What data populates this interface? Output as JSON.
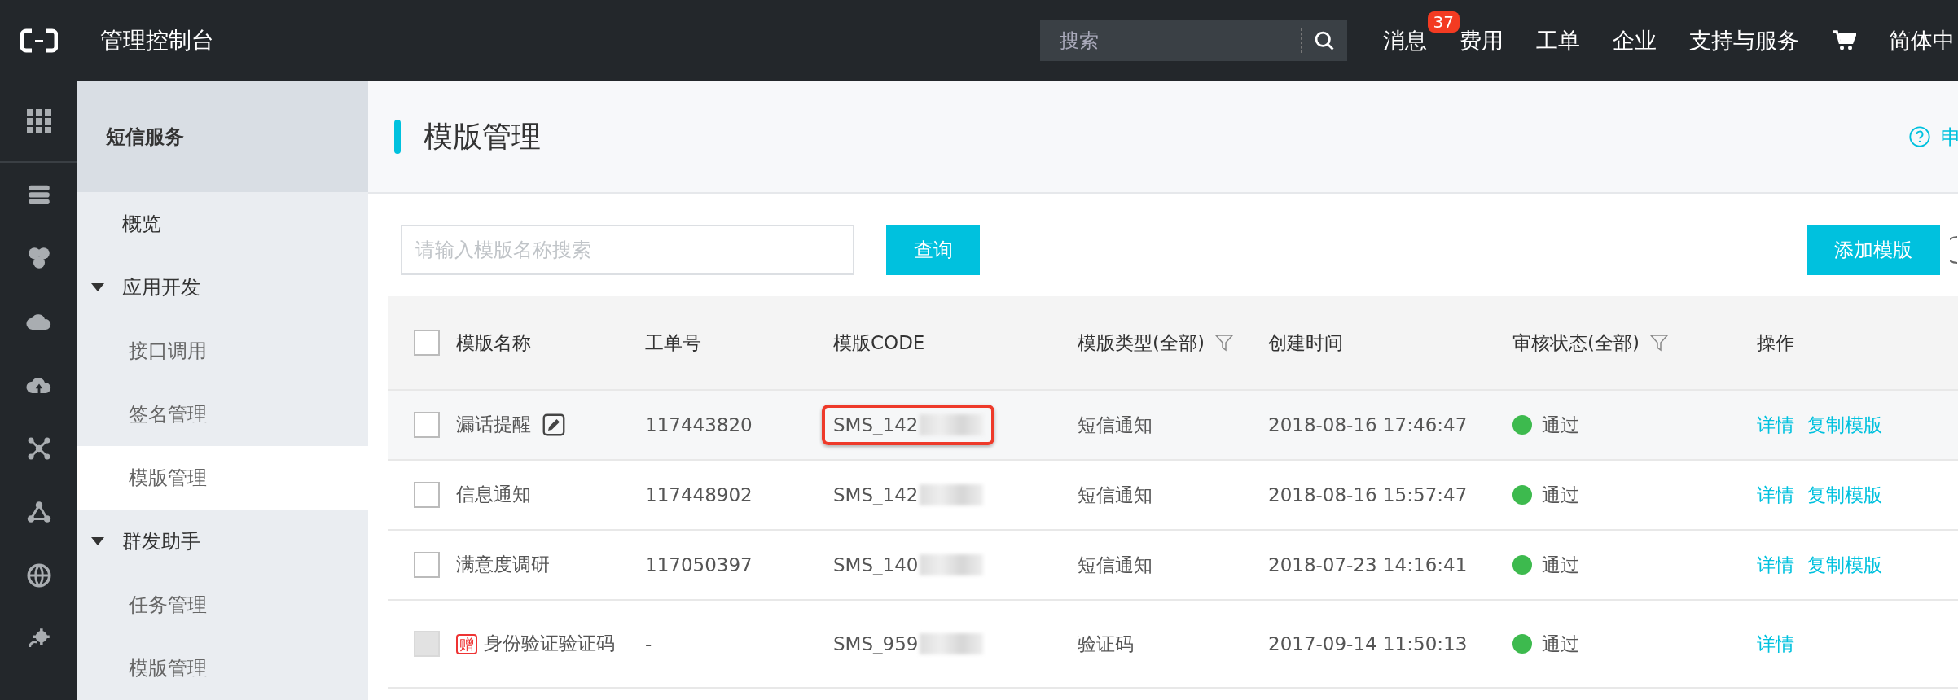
{
  "topbar": {
    "title": "管理控制台",
    "search": {
      "placeholder": "搜索"
    },
    "nav": [
      {
        "label": "消息",
        "badge": "37"
      },
      {
        "label": "费用"
      },
      {
        "label": "工单"
      },
      {
        "label": "企业"
      },
      {
        "label": "支持与服务"
      },
      {
        "kind": "cart"
      },
      {
        "label": "简体中"
      }
    ]
  },
  "sidebar": {
    "title": "短信服务",
    "items": [
      {
        "label": "概览",
        "kind": "link",
        "selected": false
      },
      {
        "label": "应用开发",
        "kind": "group",
        "expanded": true,
        "children": [
          {
            "label": "接口调用",
            "selected": false
          },
          {
            "label": "签名管理",
            "selected": false
          },
          {
            "label": "模版管理",
            "selected": true
          }
        ]
      },
      {
        "label": "群发助手",
        "kind": "group",
        "expanded": true,
        "children": [
          {
            "label": "任务管理",
            "selected": false
          },
          {
            "label": "模版管理",
            "selected": false
          }
        ]
      }
    ]
  },
  "page": {
    "title": "模版管理",
    "help_link": "申"
  },
  "toolbar": {
    "search": {
      "placeholder": "请输入模版名称搜索"
    },
    "query_button": "查询",
    "add_button": "添加模版"
  },
  "table": {
    "select_all": {
      "checked": false
    },
    "columns": [
      {
        "label": "模版名称"
      },
      {
        "label": "工单号"
      },
      {
        "label": "模版CODE"
      },
      {
        "label": "模版类型(全部)",
        "filter": true
      },
      {
        "label": "创建时间"
      },
      {
        "label": "审核状态(全部)",
        "filter": true
      },
      {
        "label": "操作"
      }
    ],
    "rows": [
      {
        "name": "漏话提醒",
        "hovered": true,
        "order_no": "117443820",
        "code": "SMS_142",
        "highlighted": true,
        "type": "短信通知",
        "created": "2018-08-16 17:46:47",
        "status": "通过",
        "color": "#3dba4e",
        "actions": [
          "详情",
          "复制模版"
        ],
        "disabled": false
      },
      {
        "name": "信息通知",
        "hovered": false,
        "order_no": "117448902",
        "code": "SMS_142",
        "highlighted": false,
        "type": "短信通知",
        "created": "2018-08-16 15:57:47",
        "status": "通过",
        "color": "#3dba4e",
        "actions": [
          "详情",
          "复制模版"
        ],
        "disabled": false
      },
      {
        "name": "满意度调研",
        "hovered": false,
        "order_no": "117050397",
        "code": "SMS_140",
        "highlighted": false,
        "type": "短信通知",
        "created": "2018-07-23 14:16:41",
        "status": "通过",
        "color": "#3dba4e",
        "actions": [
          "详情",
          "复制模版"
        ],
        "disabled": false
      },
      {
        "name": "身份验证验证码",
        "badge": "赠",
        "hovered": false,
        "order_no": "-",
        "code": "SMS_959",
        "highlighted": false,
        "type": "验证码",
        "created": "2017-09-14 11:50:13",
        "status": "通过",
        "color": "#3dba4e",
        "actions": [
          "详情"
        ],
        "disabled": true
      }
    ]
  }
}
